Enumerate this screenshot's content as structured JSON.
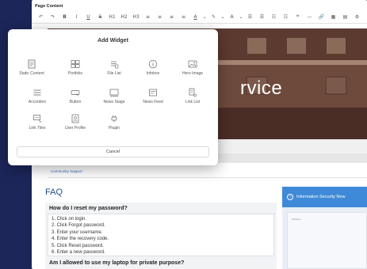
{
  "editor": {
    "title": "Page Content",
    "toolbar": [
      "↶",
      "↷",
      "B",
      "I",
      "U",
      "S",
      "H1",
      "H2",
      "H3",
      "≡",
      "≡",
      "≡",
      "≡",
      "A",
      "⌄",
      "✎",
      "⌄",
      "A",
      "⌄",
      "☰",
      "☰",
      "☷",
      "☷",
      "❝",
      "—",
      "🔗",
      "▦",
      "▤",
      "⚙"
    ]
  },
  "hero": {
    "text": "rvice"
  },
  "breadcrumb": {
    "link": "Community Support"
  },
  "faq": {
    "title": "FAQ",
    "q1": "How do I reset my password?",
    "answers": [
      "1. Click on login.",
      "2. Click Forgot password.",
      "3. Enter your username.",
      "4. Enter the recovery code.",
      "5. Click Reset password.",
      "6. Enter a new password."
    ],
    "q2": "Am I allowed to use my laptop for private purpose?"
  },
  "info_panel": {
    "title": "Information Security New",
    "small": "Sections"
  },
  "modal": {
    "title": "Add Widget",
    "widgets": [
      {
        "label": "Static Content",
        "icon": "document-icon"
      },
      {
        "label": "Portfolio",
        "icon": "portfolio-icon"
      },
      {
        "label": "File List",
        "icon": "file-list-icon"
      },
      {
        "label": "Infobox",
        "icon": "info-icon"
      },
      {
        "label": "Hero Image",
        "icon": "image-icon"
      },
      {
        "label": "Accordion",
        "icon": "accordion-icon"
      },
      {
        "label": "Button",
        "icon": "button-icon"
      },
      {
        "label": "News Stage",
        "icon": "news-stage-icon"
      },
      {
        "label": "News Feed",
        "icon": "news-feed-icon"
      },
      {
        "label": "Link List",
        "icon": "link-list-icon"
      },
      {
        "label": "Link Tiles",
        "icon": "link-tiles-icon"
      },
      {
        "label": "User Profile",
        "icon": "user-profile-icon"
      },
      {
        "label": "Plugin",
        "icon": "plugin-icon"
      }
    ],
    "cancel_label": "Cancel"
  }
}
